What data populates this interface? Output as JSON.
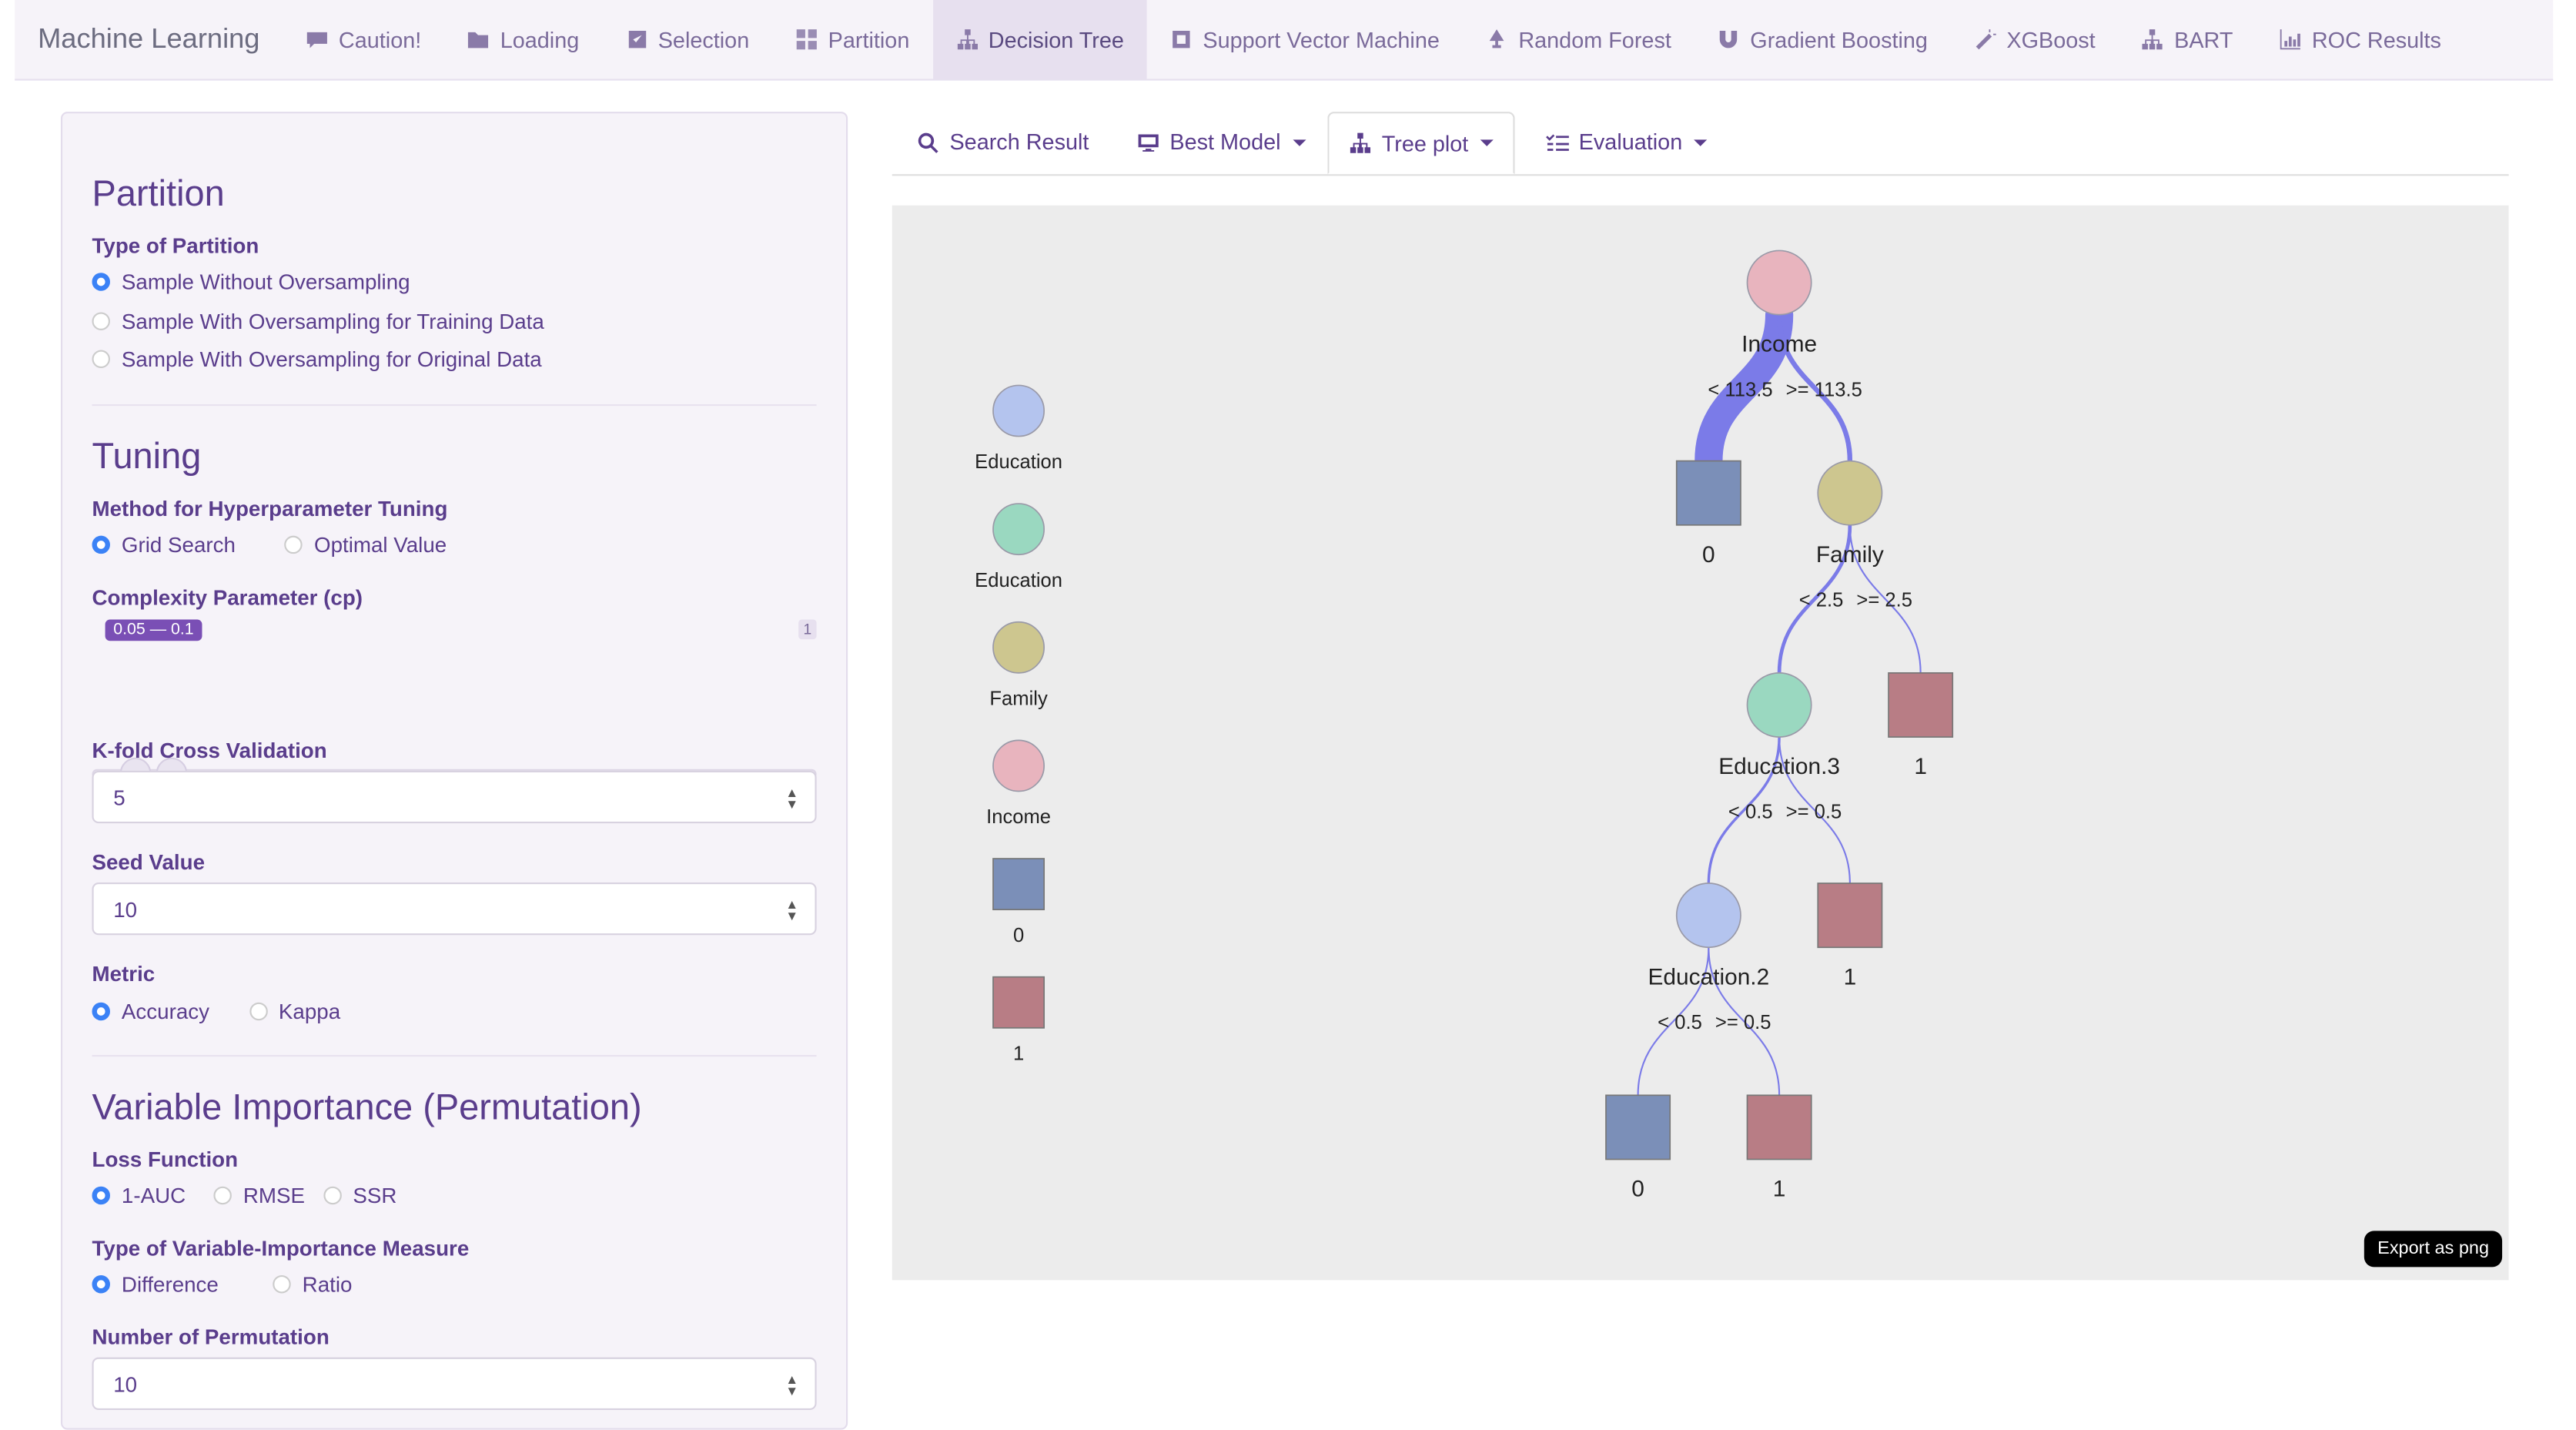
{
  "nav": {
    "brand": "Machine Learning",
    "items": [
      {
        "label": "Caution!",
        "icon": "caution-icon"
      },
      {
        "label": "Loading",
        "icon": "folder-icon"
      },
      {
        "label": "Selection",
        "icon": "checkbox-icon"
      },
      {
        "label": "Partition",
        "icon": "grid-icon"
      },
      {
        "label": "Decision Tree",
        "icon": "sitemap-icon",
        "active": true
      },
      {
        "label": "Support Vector Machine",
        "icon": "square-icon"
      },
      {
        "label": "Random Forest",
        "icon": "tree-icon"
      },
      {
        "label": "Gradient Boosting",
        "icon": "magnet-icon"
      },
      {
        "label": "XGBoost",
        "icon": "wand-icon"
      },
      {
        "label": "BART",
        "icon": "sitemap-icon"
      },
      {
        "label": "ROC Results",
        "icon": "chart-icon"
      }
    ]
  },
  "sidebar": {
    "partition": {
      "title": "Partition",
      "type_label": "Type of Partition",
      "options": [
        "Sample Without Oversampling",
        "Sample With Oversampling for Training Data",
        "Sample With Oversampling for Original Data"
      ],
      "selected": 0
    },
    "tuning": {
      "title": "Tuning",
      "method_label": "Method for Hyperparameter Tuning",
      "method_options": [
        "Grid Search",
        "Optimal Value"
      ],
      "method_selected": 0,
      "cp_label": "Complexity Parameter (cp)",
      "cp_badge": "0.05 — 0.1",
      "cp_max_label": "1",
      "cp_range": [
        0.05,
        0.1
      ],
      "cp_min": 0.01,
      "cp_max": 1,
      "cp_ticks": [
        "0.01",
        "0.11",
        "0.21",
        "0.31",
        "0.41",
        "0.51",
        "0.61",
        "0.71",
        "0.81",
        "0.91",
        "1"
      ],
      "kfold_label": "K-fold Cross Validation",
      "kfold_value": "5",
      "seed_label": "Seed Value",
      "seed_value": "10",
      "metric_label": "Metric",
      "metric_options": [
        "Accuracy",
        "Kappa"
      ],
      "metric_selected": 0
    },
    "vi": {
      "title": "Variable Importance (Permutation)",
      "loss_label": "Loss Function",
      "loss_options": [
        "1-AUC",
        "RMSE",
        "SSR"
      ],
      "loss_selected": 0,
      "measure_label": "Type of Variable-Importance Measure",
      "measure_options": [
        "Difference",
        "Ratio"
      ],
      "measure_selected": 0,
      "perm_label": "Number of Permutation",
      "perm_value": "10"
    }
  },
  "tabs": [
    {
      "label": "Search Result",
      "icon": "search-icon",
      "dropdown": false
    },
    {
      "label": "Best Model",
      "icon": "monitor-icon",
      "dropdown": true
    },
    {
      "label": "Tree plot",
      "icon": "sitemap-icon",
      "dropdown": true,
      "active": true
    },
    {
      "label": "Evaluation",
      "icon": "list-check-icon",
      "dropdown": true
    }
  ],
  "tree": {
    "colors": {
      "Income": "#e8b4be",
      "Family": "#cdc68f",
      "Education.3": "#9ad8c0",
      "Education.2": "#b4c4ee",
      "leaf0": "#7b8fb8",
      "leaf1": "#b87d85",
      "edge": "#7b7be8"
    },
    "legend": [
      {
        "label": "Education",
        "shape": "circle",
        "color": "#b4c4ee"
      },
      {
        "label": "Education",
        "shape": "circle",
        "color": "#9ad8c0"
      },
      {
        "label": "Family",
        "shape": "circle",
        "color": "#cdc68f"
      },
      {
        "label": "Income",
        "shape": "circle",
        "color": "#e8b4be"
      },
      {
        "label": "0",
        "shape": "square",
        "color": "#7b8fb8"
      },
      {
        "label": "1",
        "shape": "square",
        "color": "#b87d85"
      }
    ],
    "nodes": [
      {
        "id": "n1",
        "label": "Income",
        "type": "split",
        "color": "#e8b4be"
      },
      {
        "id": "n2",
        "label": "0",
        "type": "leaf",
        "color": "#7b8fb8"
      },
      {
        "id": "n3",
        "label": "Family",
        "type": "split",
        "color": "#cdc68f"
      },
      {
        "id": "n4",
        "label": "Education.3",
        "type": "split",
        "color": "#9ad8c0"
      },
      {
        "id": "n5",
        "label": "1",
        "type": "leaf",
        "color": "#b87d85"
      },
      {
        "id": "n6",
        "label": "Education.2",
        "type": "split",
        "color": "#b4c4ee"
      },
      {
        "id": "n7",
        "label": "1",
        "type": "leaf",
        "color": "#b87d85"
      },
      {
        "id": "n8",
        "label": "0",
        "type": "leaf",
        "color": "#7b8fb8"
      },
      {
        "id": "n9",
        "label": "1",
        "type": "leaf",
        "color": "#b87d85"
      }
    ],
    "edges": [
      {
        "from": "n1",
        "to": "n2",
        "label": "< 113.5",
        "weight": 0.85
      },
      {
        "from": "n1",
        "to": "n3",
        "label": ">= 113.5",
        "weight": 0.15
      },
      {
        "from": "n3",
        "to": "n4",
        "label": "< 2.5",
        "weight": 0.11
      },
      {
        "from": "n3",
        "to": "n5",
        "label": ">= 2.5",
        "weight": 0.04
      },
      {
        "from": "n4",
        "to": "n6",
        "label": "< 0.5",
        "weight": 0.08
      },
      {
        "from": "n4",
        "to": "n7",
        "label": ">= 0.5",
        "weight": 0.03
      },
      {
        "from": "n6",
        "to": "n8",
        "label": "< 0.5",
        "weight": 0.05
      },
      {
        "from": "n6",
        "to": "n9",
        "label": ">= 0.5",
        "weight": 0.03
      }
    ],
    "export_label": "Export as png"
  }
}
